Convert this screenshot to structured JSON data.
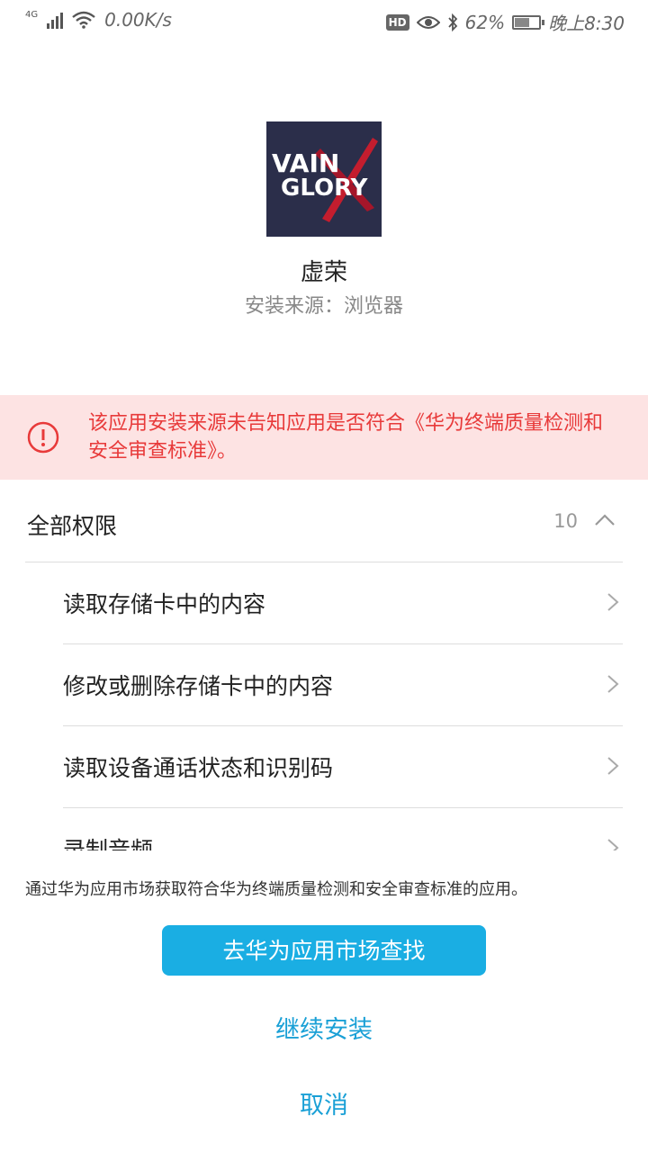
{
  "status_bar": {
    "network_type": "4G",
    "speed": "0.00K/s",
    "hd_label": "HD",
    "battery_percent": "62%",
    "battery_level": 0.62,
    "time": "晚上8:30"
  },
  "app": {
    "icon_text_line1": "VAIN",
    "icon_text_line2": "GLORY",
    "name": "虚荣",
    "source": "安装来源：浏览器"
  },
  "warning": {
    "icon": "alert-circle-icon",
    "text": "该应用安装来源未告知应用是否符合《华为终端质量检测和安全审查标准》。",
    "color": "#e83a3a"
  },
  "permissions": {
    "title": "全部权限",
    "count": "10",
    "items": [
      {
        "label": "读取存储卡中的内容"
      },
      {
        "label": "修改或删除存储卡中的内容"
      },
      {
        "label": "读取设备通话状态和识别码"
      },
      {
        "label": "录制音频"
      }
    ]
  },
  "footer_note": "通过华为应用市场获取符合华为终端质量检测和安全审查标准的应用。",
  "buttons": {
    "primary": "去华为应用市场查找",
    "continue": "继续安装",
    "cancel": "取消"
  },
  "colors": {
    "accent": "#1aaee3",
    "warning_bg": "#fde3e3"
  }
}
